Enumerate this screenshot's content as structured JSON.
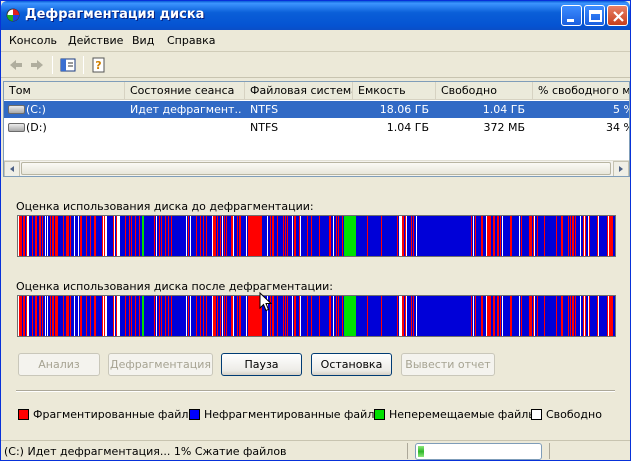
{
  "window": {
    "title": "Дефрагментация диска",
    "accent": "#0a5fd8"
  },
  "menu": [
    {
      "label": "Консоль"
    },
    {
      "label": "Действие"
    },
    {
      "label": "Вид"
    },
    {
      "label": "Справка"
    }
  ],
  "toolbar": {
    "icons": [
      "back-arrow-icon",
      "forward-arrow-icon",
      "show-hide-console-tree-icon",
      "help-icon"
    ]
  },
  "columns": [
    "Том",
    "Состояние сеанса",
    "Файловая система",
    "Емкость",
    "Свободно",
    "% свободного места"
  ],
  "volumes": [
    {
      "name": "(C:)",
      "status": "Идет дефрагмент...",
      "fs": "NTFS",
      "capacity": "18.06 ГБ",
      "free": "1.04 ГБ",
      "free_pct": "5 %",
      "selected": true
    },
    {
      "name": "(D:)",
      "status": "",
      "fs": "NTFS",
      "capacity": "1.04 ГБ",
      "free": "372 МБ",
      "free_pct": "34 %",
      "selected": false
    }
  ],
  "analysis": {
    "before_label": "Оценка использования диска до дефрагментации:",
    "after_label": "Оценка использования диска после дефрагментации:"
  },
  "buttons": {
    "analyze": "Анализ",
    "defrag": "Дефрагментация",
    "pause": "Пауза",
    "stop": "Остановка",
    "report": "Вывести отчет"
  },
  "legend": [
    {
      "label": "Фрагментированные файлы",
      "color": "#ff0000"
    },
    {
      "label": "Нефрагментированные файлы",
      "color": "#0000ff"
    },
    {
      "label": "Неперемещаемые файлы",
      "color": "#00e000"
    },
    {
      "label": "Свободно",
      "color": "#ffffff"
    }
  ],
  "colors": {
    "fragmented": "#ff0000",
    "contiguous": "#0000d8",
    "unmovable": "#00e000",
    "free": "#ffffff"
  },
  "status": {
    "text": "(C:) Идет дефрагментация... 1%  Сжатие файлов",
    "progress": 0.01
  }
}
